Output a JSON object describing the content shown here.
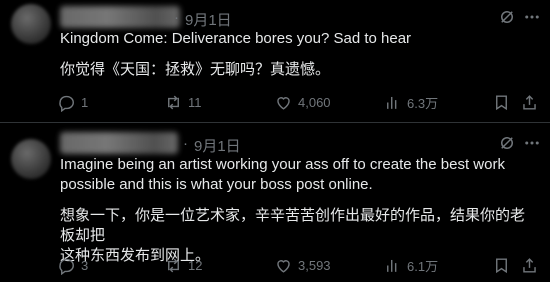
{
  "tweets": [
    {
      "separator": "·",
      "date": "9月1日",
      "text_lines": [
        "Kingdom Come: Deliverance bores you? Sad to hear",
        "你觉得《天国：拯救》无聊吗？真遗憾。"
      ],
      "replies": "1",
      "reposts": "11",
      "likes": "4,060",
      "views": "6.3万"
    },
    {
      "separator": "·",
      "date": "9月1日",
      "text_lines": [
        "Imagine being an artist working your ass off to create the best work",
        "possible and this is what your boss post online.",
        "想象一下，你是一位艺术家，辛辛苦苦创作出最好的作品，结果你的老板却把",
        "这种东西发布到网上。"
      ],
      "replies": "3",
      "reposts": "12",
      "likes": "3,593",
      "views": "6.1万"
    }
  ],
  "icons": {
    "grok": "grok-icon",
    "more": "more-icon",
    "reply": "reply-icon",
    "repost": "repost-icon",
    "like": "like-icon",
    "views": "views-icon",
    "bookmark": "bookmark-icon",
    "share": "share-icon"
  },
  "colors": {
    "background": "#000000",
    "text": "#e7e9ea",
    "secondary": "#71767b",
    "divider": "#2f3336"
  }
}
